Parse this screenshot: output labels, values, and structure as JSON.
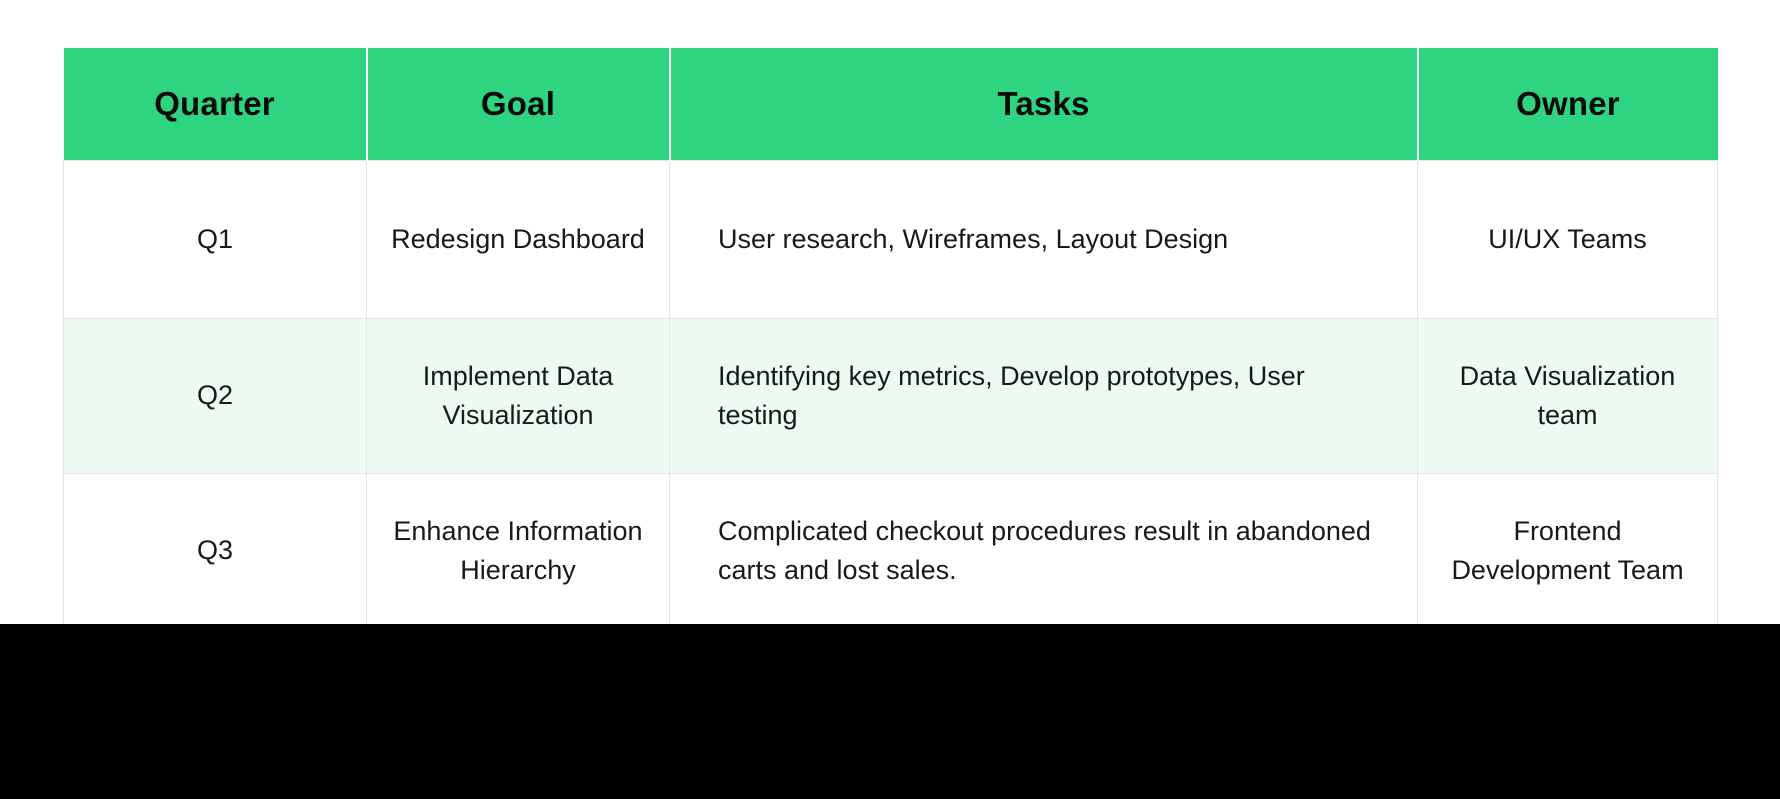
{
  "table": {
    "columns": [
      {
        "key": "quarter",
        "label": "Quarter"
      },
      {
        "key": "goal",
        "label": "Goal"
      },
      {
        "key": "tasks",
        "label": "Tasks"
      },
      {
        "key": "owner",
        "label": "Owner"
      }
    ],
    "header": {
      "quarter": "Quarter",
      "goal": "Goal",
      "tasks": "Tasks",
      "owner": "Owner"
    },
    "rows": [
      {
        "quarter": "Q1",
        "goal": "Redesign Dashboard",
        "tasks": "User research, Wireframes, Layout Design",
        "owner": "UI/UX Teams"
      },
      {
        "quarter": "Q2",
        "goal": "Implement Data Visualization",
        "tasks": "Identifying key metrics, Develop prototypes, User testing",
        "owner": "Data Visualization team"
      },
      {
        "quarter": "Q3",
        "goal": "Enhance Information Hierarchy",
        "tasks": "Complicated checkout procedures result in abandoned carts and lost sales.",
        "owner": "Frontend Development Team"
      }
    ]
  },
  "colors": {
    "header_background": "#2ed47f",
    "header_text": "#0a0a0a",
    "row_alt_background": "#edfaf2",
    "row_background": "#ffffff",
    "cell_text": "#17191c",
    "grid_line": "#e4e7e6",
    "bottom_band": "#000000"
  }
}
